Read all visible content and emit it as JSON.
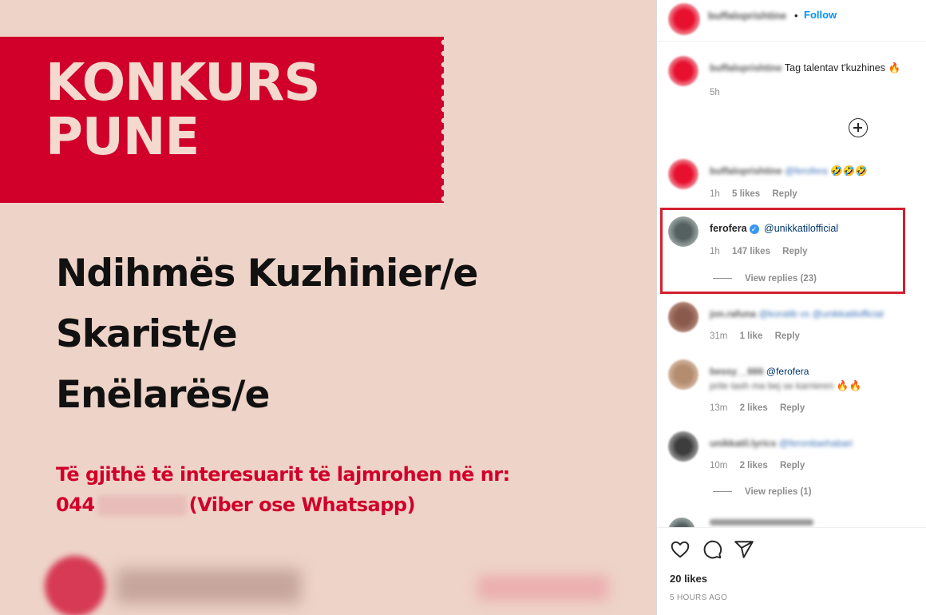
{
  "post": {
    "banner_line1": "KONKURS",
    "banner_line2": "PUNE",
    "positions": [
      "Ndihmës Kuzhinier/e",
      "Skarist/e",
      "Enëlarës/e"
    ],
    "contact_line1": "Të gjithë të interesuarit të lajmrohen në nr:",
    "contact_prefix": "044",
    "contact_suffix": "(Viber ose Whatsapp)"
  },
  "header": {
    "username_blurred": "buffaloprishtine",
    "separator": "•",
    "follow_label": "Follow"
  },
  "caption": {
    "username_blurred": "buffaloprishtine",
    "text": "Tag talentav t'kuzhines",
    "emoji": "🔥",
    "time": "5h"
  },
  "comments": [
    {
      "username_blurred": "buffaloprishtine",
      "mention_blurred": "@ferofera",
      "emoji": "🤣🤣🤣",
      "time": "1h",
      "likes": "5 likes",
      "reply_label": "Reply"
    },
    {
      "username": "ferofera",
      "verified_mark": "✓",
      "mention": "@unikkatilofficial",
      "time": "1h",
      "likes": "147 likes",
      "reply_label": "Reply",
      "view_replies": "View replies (23)"
    },
    {
      "username_blurred": "jon.rafuna",
      "text_blurred": "@koratib vs @unikkatilofficial",
      "time": "31m",
      "likes": "1 like",
      "reply_label": "Reply"
    },
    {
      "username_blurred": "bessy__666",
      "mention": "@ferofera",
      "text_blurred": "prite tash ma bej se karrieren",
      "emoji": "🔥🔥",
      "time": "13m",
      "likes": "2 likes",
      "reply_label": "Reply"
    },
    {
      "username_blurred": "unikkatil.lyrics",
      "text_blurred": "@feronitaehabari",
      "time": "10m",
      "likes": "2 likes",
      "reply_label": "Reply",
      "view_replies": "View replies (1)"
    }
  ],
  "footer": {
    "likes": "20 likes",
    "time_ago": "5 HOURS AGO"
  },
  "colors": {
    "brand_red": "#d0002a",
    "follow_blue": "#0095f6",
    "highlight_red": "#d2202f",
    "post_background": "#eed3c8"
  },
  "icons": [
    "heart-icon",
    "comment-icon",
    "share-icon",
    "add-comment-icon",
    "verified-badge-icon"
  ]
}
